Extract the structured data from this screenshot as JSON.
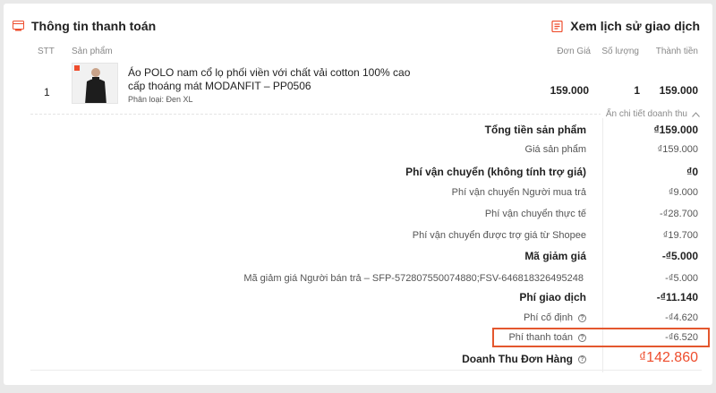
{
  "header": {
    "title": "Thông tin thanh toán",
    "history_label": "Xem lịch sử giao dịch"
  },
  "table": {
    "columns": [
      "STT",
      "Sản phẩm",
      "Đơn Giá",
      "Số lượng",
      "Thành tiền"
    ],
    "rows": [
      {
        "index": "1",
        "name": "Áo POLO nam cổ lọ phối viền với chất vải cotton 100% cao cấp thoáng mát MODANFIT – PP0506",
        "variant": "Phân loại: Đen XL",
        "unit_price": "159.000",
        "quantity": "1",
        "total": "159.000"
      }
    ]
  },
  "toggle_label": "Ẩn chi tiết doanh thu",
  "summary": [
    {
      "label": "Tổng tiền sản phẩm",
      "value": "₫159.000",
      "bold": true
    },
    {
      "label": "Giá sản phẩm",
      "value": "₫159.000",
      "bold": false
    },
    {
      "label": "Phí vận chuyển (không tính trợ giá)",
      "value": "₫0",
      "bold": true
    },
    {
      "label": "Phí vận chuyển Người mua trả",
      "value": "₫9.000",
      "bold": false
    },
    {
      "label": "Phí vận chuyển thực tế",
      "value": "-₫28.700",
      "bold": false
    },
    {
      "label": "Phí vận chuyển được trợ giá từ Shopee",
      "value": "₫19.700",
      "bold": false
    },
    {
      "label": "Mã giảm giá",
      "value": "-₫5.000",
      "bold": true
    },
    {
      "label": "Mã giảm giá Người bán trả – SFP-572807550074880;FSV-646818326495248",
      "value": "-₫5.000",
      "bold": false
    },
    {
      "label": "Phí giao dịch",
      "value": "-₫11.140",
      "bold": true
    },
    {
      "label": "Phí cố định",
      "value": "-₫4.620",
      "bold": false
    },
    {
      "label": "Phí thanh toán",
      "value": "-₫6.520",
      "bold": false
    }
  ],
  "grand_total": {
    "label": "Doanh Thu Đơn Hàng",
    "value": "₫142.860"
  },
  "colors": {
    "accent": "#ee4d2d",
    "highlight_border": "#e4572e"
  }
}
